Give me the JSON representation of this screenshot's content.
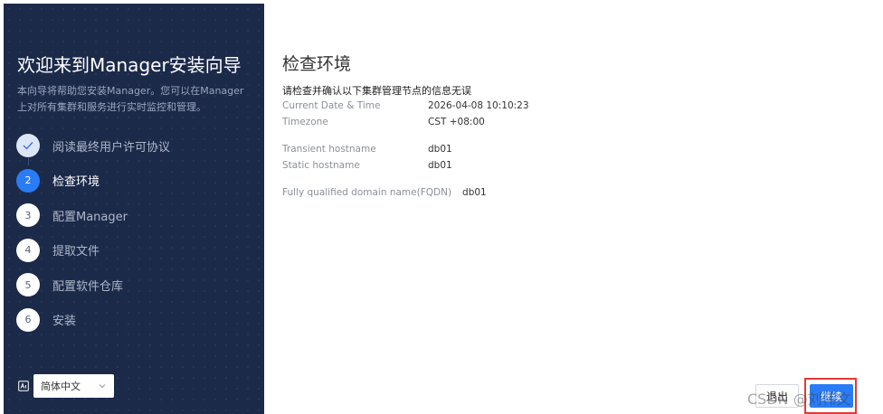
{
  "sidebar": {
    "title": "欢迎来到Manager安装向导",
    "description": "本向导将帮助您安装Manager。您可以在Manager上对所有集群和服务进行实时监控和管理。",
    "steps": [
      {
        "number": "",
        "label": "阅读最终用户许可协议",
        "state": "done"
      },
      {
        "number": "2",
        "label": "检查环境",
        "state": "active"
      },
      {
        "number": "3",
        "label": "配置Manager",
        "state": "pending"
      },
      {
        "number": "4",
        "label": "提取文件",
        "state": "pending"
      },
      {
        "number": "5",
        "label": "配置软件仓库",
        "state": "pending"
      },
      {
        "number": "6",
        "label": "安装",
        "state": "pending"
      }
    ],
    "language": {
      "selected": "简体中文",
      "icon": "language-icon"
    }
  },
  "main": {
    "title": "检查环境",
    "subtitle": "请检查并确认以下集群管理节点的信息无误",
    "fields": {
      "date_label": "Current Date & Time",
      "date_value": "2026-04-08 10:10:23",
      "timezone_label": "Timezone",
      "timezone_value": "CST +08:00",
      "transient_label": "Transient hostname",
      "transient_value": "db01",
      "static_label": "Static hostname",
      "static_value": "db01",
      "fqdn_label": "Fully qualified domain name(FQDN)",
      "fqdn_value": "db01"
    }
  },
  "footer": {
    "exit_label": "退出",
    "next_label": "继续"
  },
  "watermark": "CSDN @刘伟文",
  "colors": {
    "sidebar_bg": "#1c2a4a",
    "accent": "#2a7cf6",
    "highlight_border": "#e53935"
  }
}
